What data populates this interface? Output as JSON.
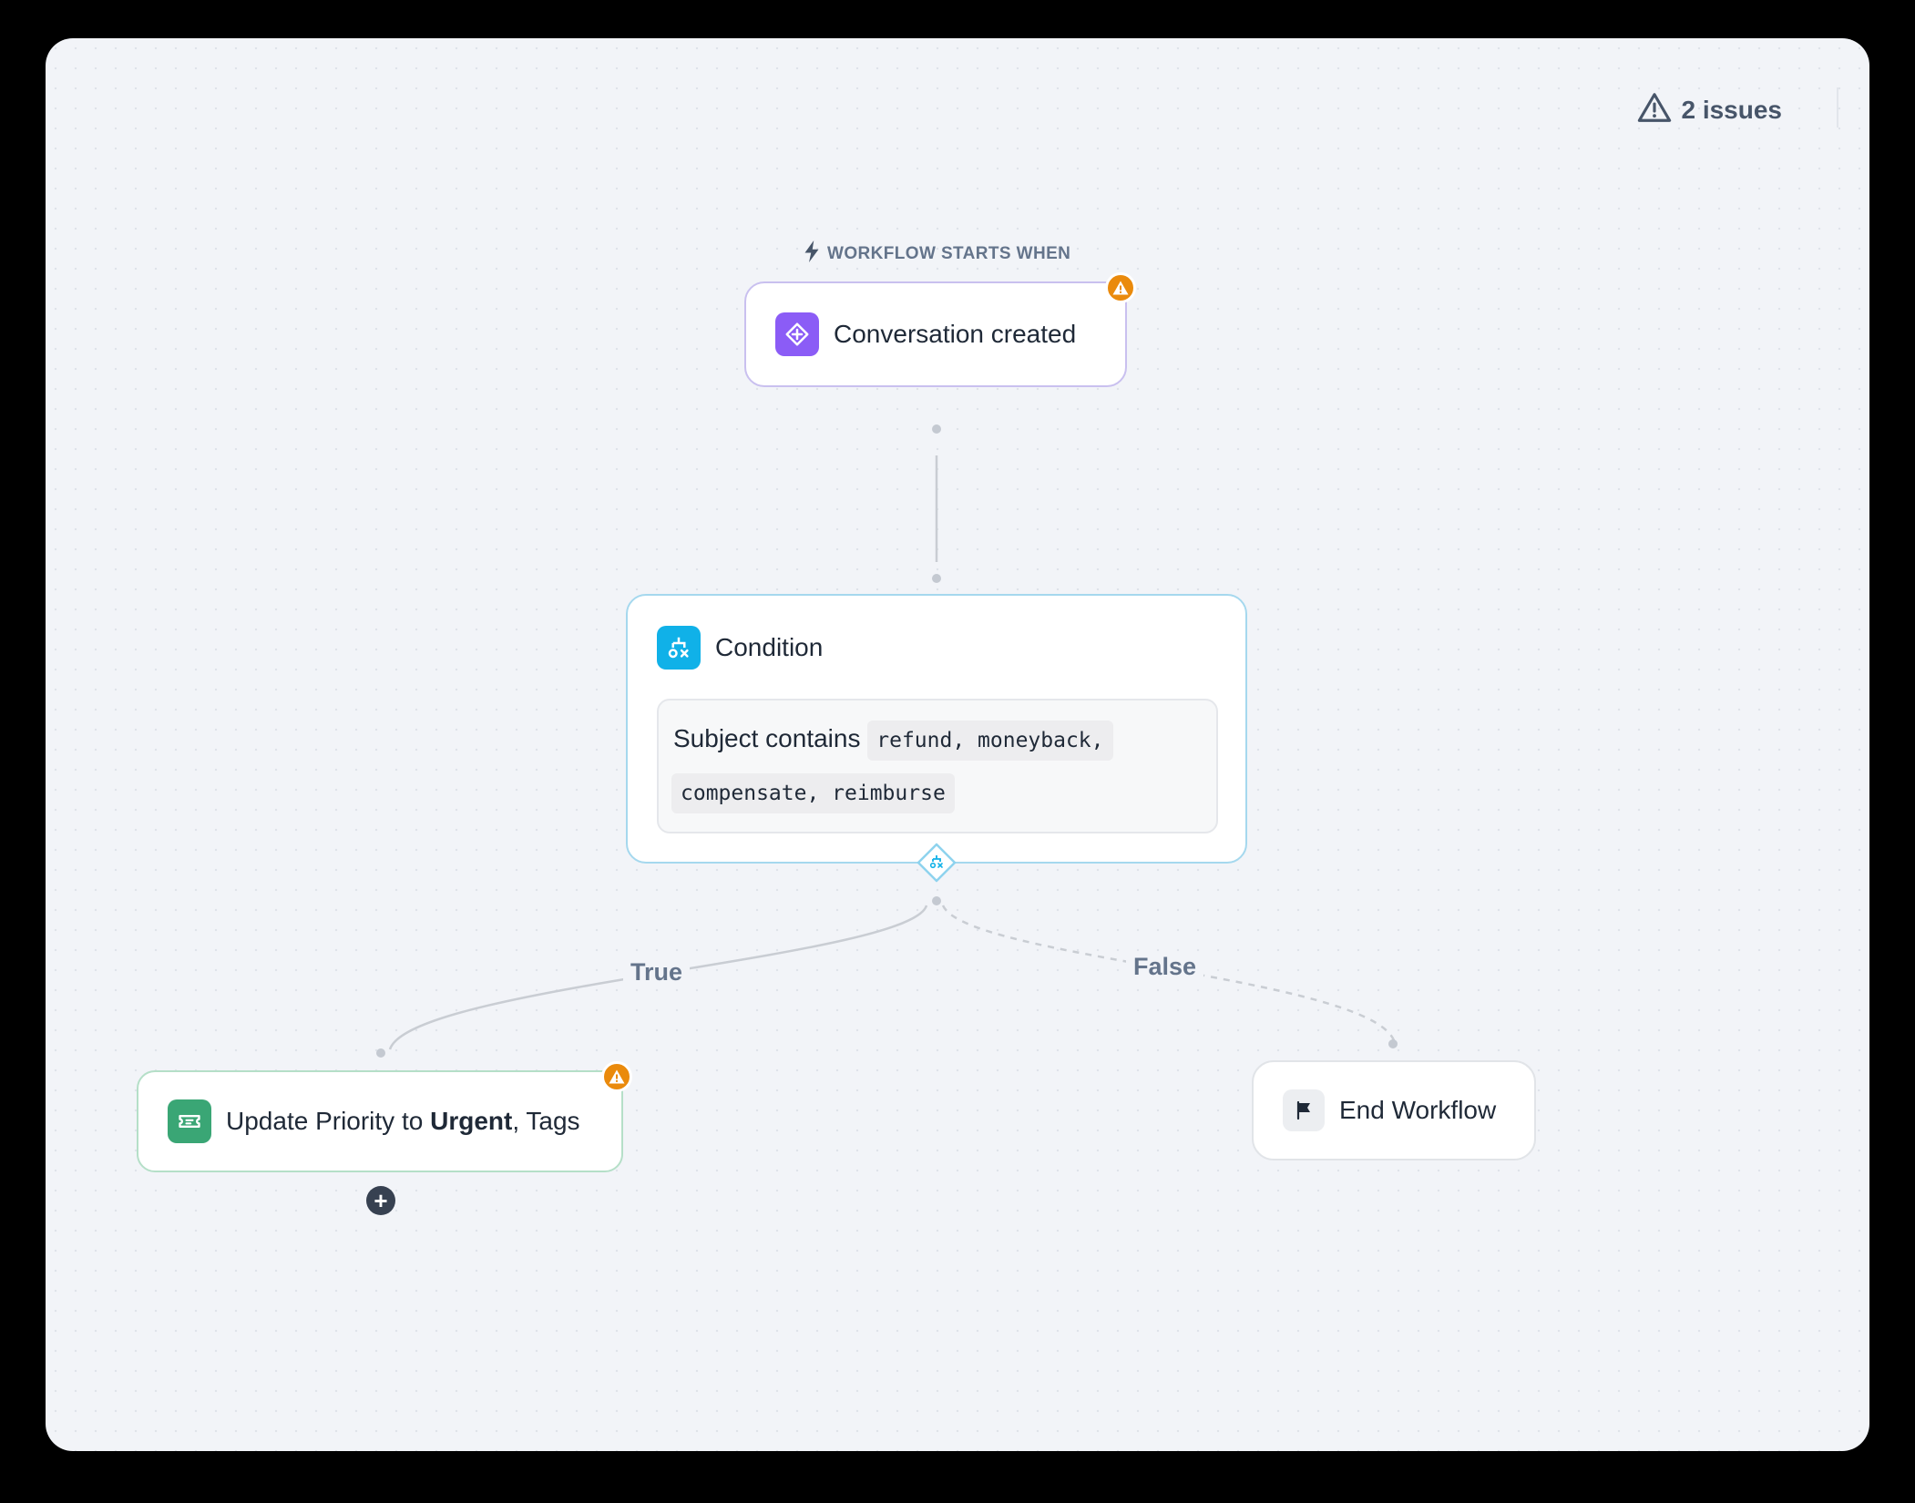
{
  "header": {
    "issues_label": "2 issues"
  },
  "trigger": {
    "section_label": "WORKFLOW STARTS WHEN",
    "title": "Conversation created"
  },
  "condition": {
    "title": "Condition",
    "text_prefix": "Subject contains",
    "keywords_line1": "refund, moneyback,",
    "keywords_line2": "compensate, reimburse"
  },
  "branches": {
    "true_label": "True",
    "false_label": "False"
  },
  "action": {
    "text_prefix": "Update Priority to",
    "priority": "Urgent",
    "text_suffix": ", Tags"
  },
  "end": {
    "title": "End Workflow"
  },
  "colors": {
    "trigger_accent": "#8b5cf6",
    "condition_accent": "#0ea5e9",
    "action_accent": "#3aa675",
    "warning": "#ea8a0c"
  }
}
